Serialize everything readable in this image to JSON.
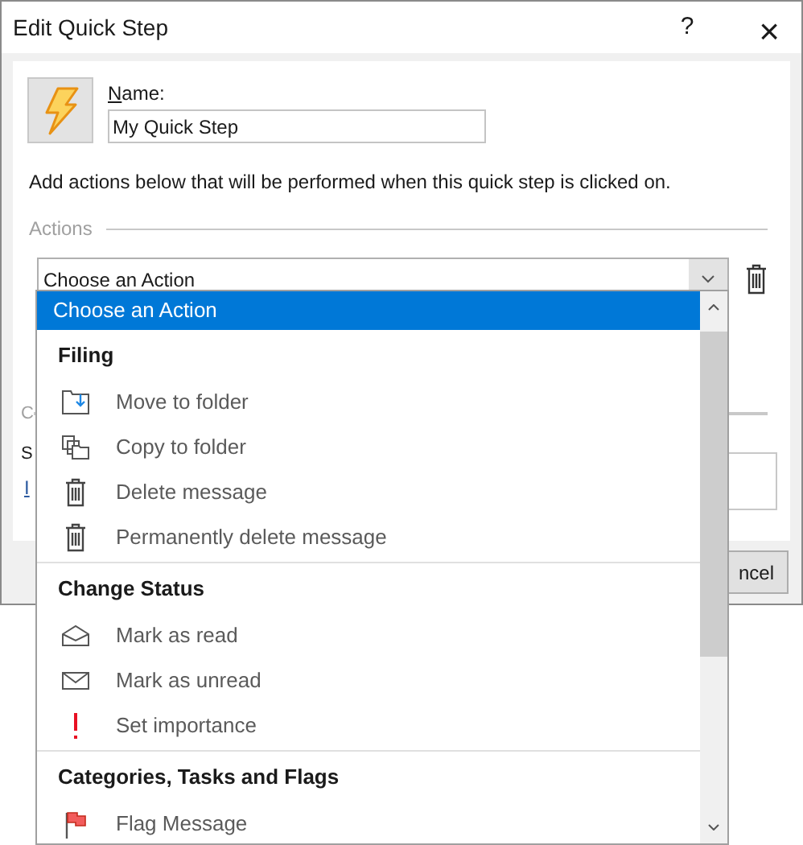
{
  "window": {
    "title": "Edit Quick Step",
    "help_button": "?",
    "close_button": "×"
  },
  "name_field": {
    "label": "Name:",
    "value": "My Quick Step"
  },
  "description": "Add actions below that will be performed when this quick step is clicked on.",
  "actions_section": {
    "label": "Actions"
  },
  "action_combo": {
    "value": "Choose an Action"
  },
  "covered": {
    "section_label": "C",
    "text": "S",
    "link": "I",
    "cancel_button": "ncel"
  },
  "dropdown": {
    "items": [
      {
        "kind": "plain",
        "label": "Choose an Action",
        "selected": true
      },
      {
        "kind": "header",
        "label": "Filing"
      },
      {
        "kind": "move",
        "label": "Move to folder",
        "selected": false
      },
      {
        "kind": "copy",
        "label": "Copy to folder",
        "selected": false
      },
      {
        "kind": "delete",
        "label": "Delete message",
        "selected": false
      },
      {
        "kind": "delete",
        "label": "Permanently delete message",
        "selected": false
      },
      {
        "kind": "separator"
      },
      {
        "kind": "header",
        "label": "Change Status"
      },
      {
        "kind": "read",
        "label": "Mark as read",
        "selected": false
      },
      {
        "kind": "unread",
        "label": "Mark as unread",
        "selected": false
      },
      {
        "kind": "importance",
        "label": "Set importance",
        "selected": false
      },
      {
        "kind": "separator"
      },
      {
        "kind": "header",
        "label": "Categories, Tasks and Flags"
      },
      {
        "kind": "flag",
        "label": "Flag Message",
        "selected": false
      }
    ]
  }
}
